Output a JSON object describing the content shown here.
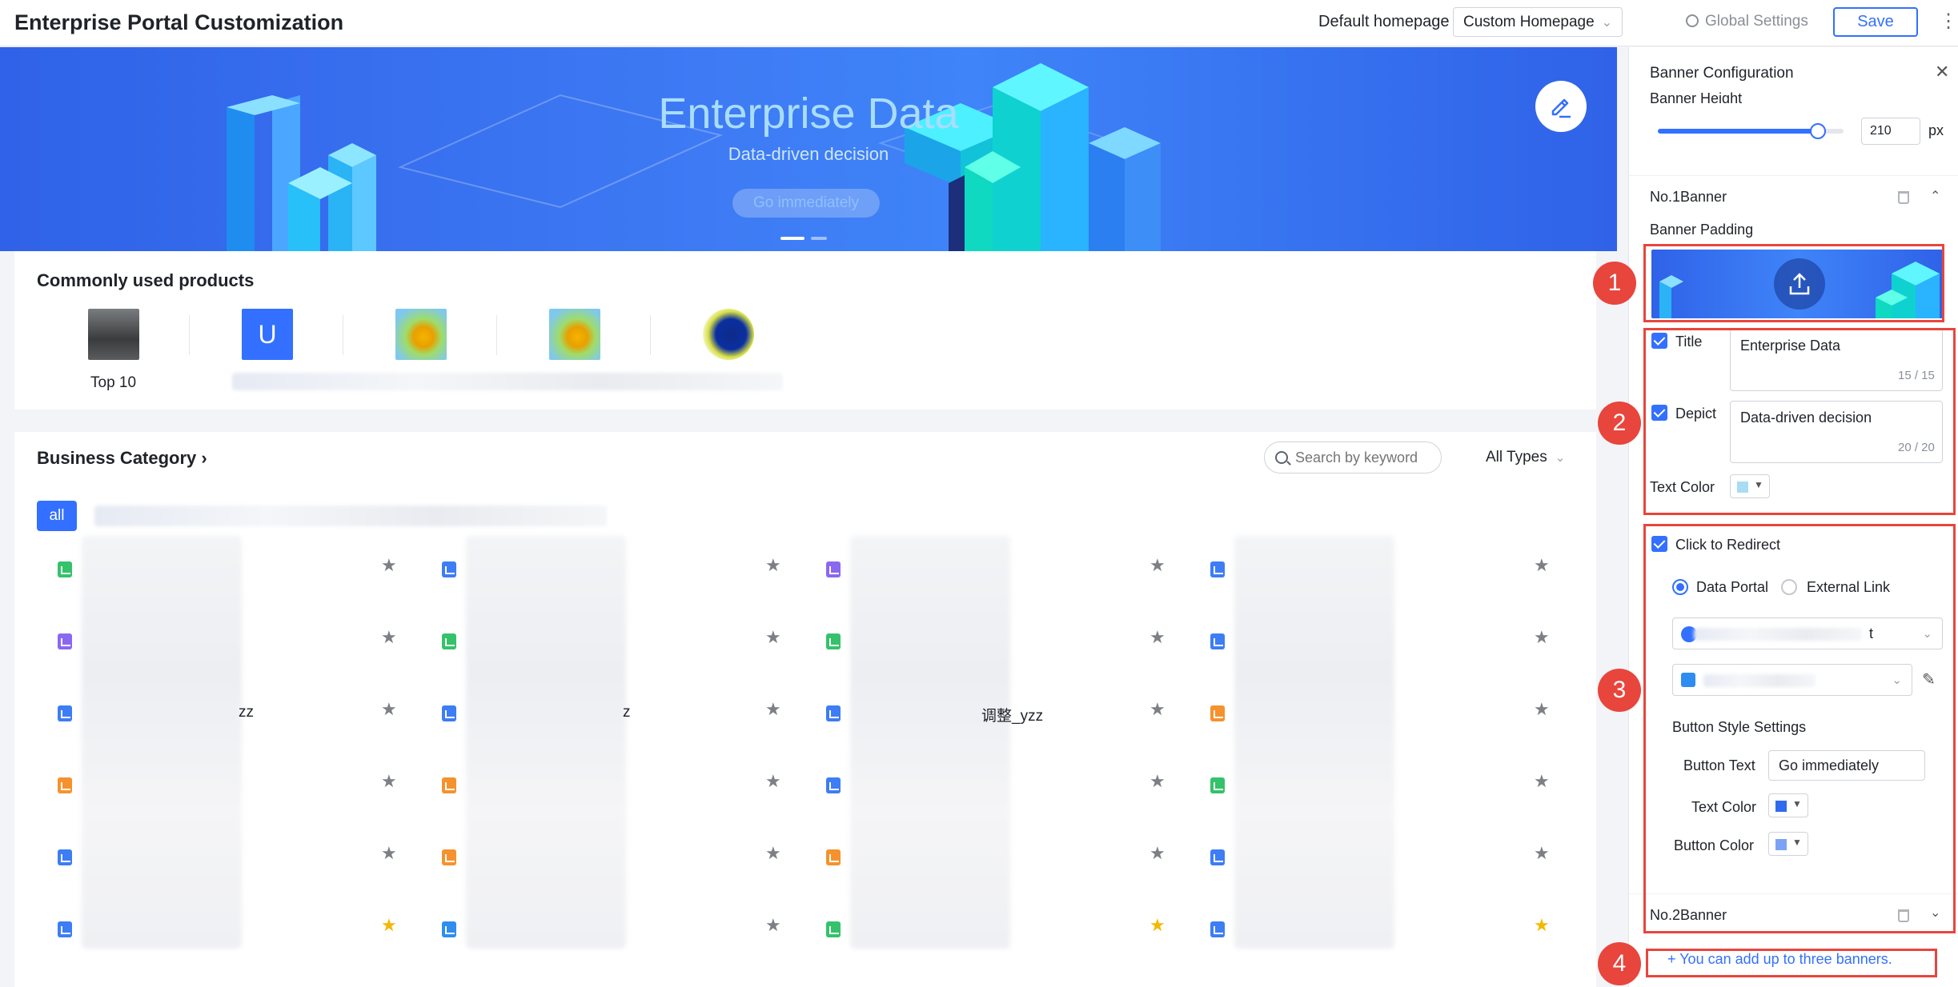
{
  "header": {
    "title": "Enterprise Portal Customization",
    "homepage_label": "Default homepage",
    "homepage_value": "Custom Homepage",
    "global_settings": "Global Settings",
    "save": "Save"
  },
  "banner": {
    "title": "Enterprise Data",
    "subtitle": "Data-driven decision",
    "button": "Go immediately",
    "active_slide": 1,
    "slides": 2
  },
  "products": {
    "title": "Commonly used products",
    "items": [
      {
        "label": "Top 10",
        "icon": "photo-icon"
      },
      {
        "label": "",
        "letter": "U",
        "icon": "user-letter-icon"
      },
      {
        "label": "",
        "icon": "sunflower-icon"
      },
      {
        "label": "",
        "icon": "sunflower-icon"
      },
      {
        "label": "",
        "icon": "dark-circle-icon"
      }
    ]
  },
  "business": {
    "title": "Business Category",
    "search_placeholder": "Search by keyword",
    "types": "All Types",
    "all_tag": "all",
    "partial_texts": [
      "zz",
      "z",
      "调整_yzz"
    ]
  },
  "panel": {
    "title": "Banner Configuration",
    "height_label": "Banner Height",
    "height_value": "210",
    "height_unit": "px",
    "height_fraction": 0.86,
    "banner1": "No.1Banner",
    "padding_label": "Banner Padding",
    "title_label": "Title",
    "title_value": "Enterprise Data",
    "title_count": "15 / 15",
    "depict_label": "Depict",
    "depict_value": "Data-driven decision",
    "depict_count": "20 / 20",
    "text_color_label": "Text Color",
    "redirect_label": "Click to Redirect",
    "radio_portal": "Data Portal",
    "radio_external": "External Link",
    "select1_suffix": "t",
    "button_style_title": "Button Style Settings",
    "button_text_label": "Button Text",
    "button_text_value": "Go immediately",
    "btn_text_color_label": "Text Color",
    "btn_color_label": "Button Color",
    "banner2": "No.2Banner",
    "add_banner": "You can add up to three banners."
  },
  "annotations": [
    "1",
    "2",
    "3",
    "4"
  ],
  "colors": {
    "accent": "#3370ff",
    "annotation": "#e8453c",
    "banner_text_color": "#a8dcf5",
    "button_text_color": "#2f6bef",
    "button_color": "#7ba3f5"
  }
}
